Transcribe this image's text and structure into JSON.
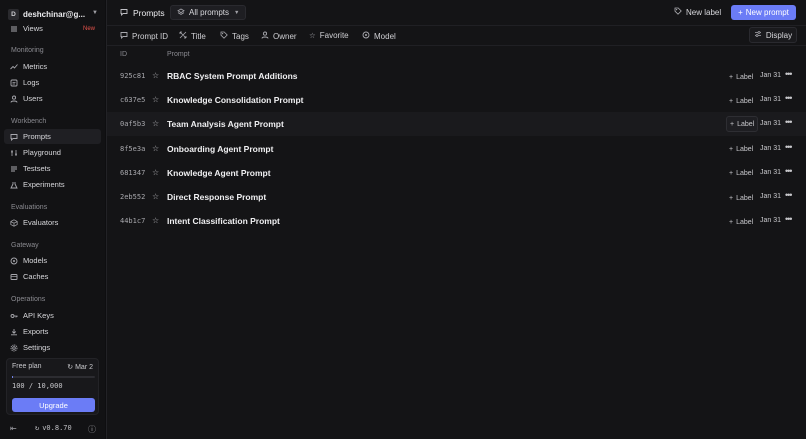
{
  "sidebar": {
    "account": {
      "initial": "D",
      "name": "deshchinar@g..."
    },
    "views": {
      "label": "Views",
      "badge": "New"
    },
    "sections": {
      "monitoring": "Monitoring",
      "workbench": "Workbench",
      "evaluations": "Evaluations",
      "gateway": "Gateway",
      "operations": "Operations"
    },
    "items": {
      "metrics": "Metrics",
      "logs": "Logs",
      "users": "Users",
      "prompts": "Prompts",
      "playground": "Playground",
      "testsets": "Testsets",
      "experiments": "Experiments",
      "evaluators": "Evaluators",
      "models": "Models",
      "caches": "Caches",
      "api_keys": "API Keys",
      "exports": "Exports",
      "settings": "Settings"
    },
    "plan": {
      "title": "Free plan",
      "renew_date": "Mar 2",
      "usage": "100 / 10,000",
      "usage_fraction": 0.01,
      "upgrade_label": "Upgrade"
    },
    "version": "v0.8.70"
  },
  "header": {
    "title": "Prompts",
    "filter_dropdown": "All prompts",
    "new_label": "New label",
    "new_prompt": "New prompt"
  },
  "filters": {
    "prompt_id": "Prompt ID",
    "title": "Title",
    "tags": "Tags",
    "owner": "Owner",
    "favorite": "Favorite",
    "model": "Model",
    "display": "Display"
  },
  "table": {
    "columns": {
      "id": "ID",
      "prompt": "Prompt"
    },
    "label_action": "Label",
    "rows": [
      {
        "id": "925c81",
        "name": "RBAC System Prompt Additions",
        "date": "Jan 31"
      },
      {
        "id": "c637e5",
        "name": "Knowledge Consolidation Prompt",
        "date": "Jan 31"
      },
      {
        "id": "0af5b3",
        "name": "Team Analysis Agent Prompt",
        "date": "Jan 31"
      },
      {
        "id": "8f5e3a",
        "name": "Onboarding Agent Prompt",
        "date": "Jan 31"
      },
      {
        "id": "681347",
        "name": "Knowledge Agent Prompt",
        "date": "Jan 31"
      },
      {
        "id": "2eb552",
        "name": "Direct Response Prompt",
        "date": "Jan 31"
      },
      {
        "id": "44b1c7",
        "name": "Intent Classification Prompt",
        "date": "Jan 31"
      }
    ]
  },
  "colors": {
    "accent": "#6b7cf6",
    "new_badge": "#e5534b"
  }
}
